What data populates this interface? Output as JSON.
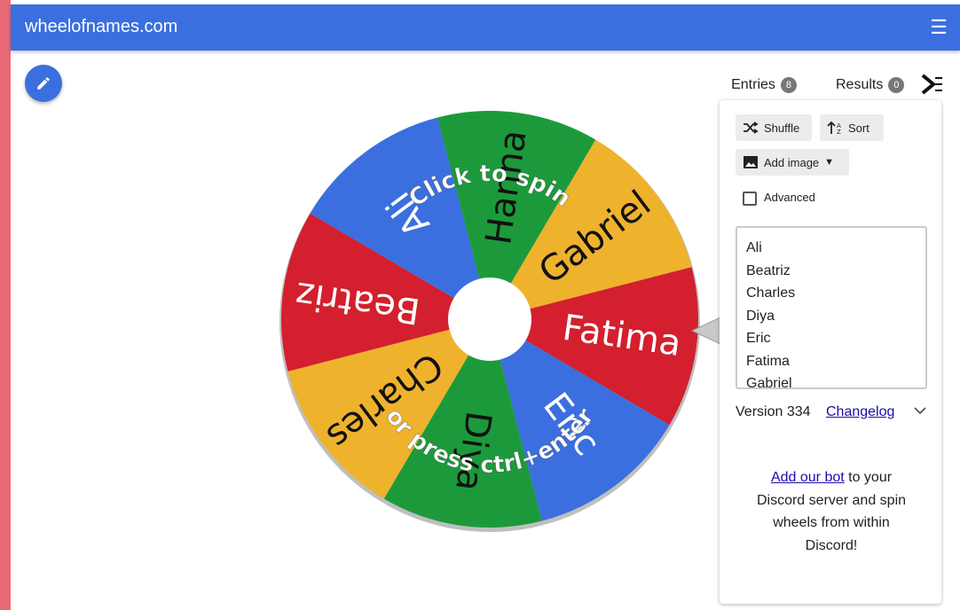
{
  "site": {
    "title": "wheelofnames.com"
  },
  "wheel": {
    "entries": [
      "Ali",
      "Beatriz",
      "Charles",
      "Diya",
      "Eric",
      "Fatima",
      "Gabriel",
      "Hanna"
    ],
    "segments": [
      {
        "label": "Fatima",
        "color": "#d41f2e"
      },
      {
        "label": "Eric",
        "color": "#3b6fe0"
      },
      {
        "label": "Diya",
        "color": "#1c9a3b"
      },
      {
        "label": "Charles",
        "color": "#eeb22d"
      },
      {
        "label": "Beatriz",
        "color": "#d41f2e"
      },
      {
        "label": "Ali",
        "color": "#3b6fe0"
      },
      {
        "label": "Hanna",
        "color": "#1c9a3b"
      },
      {
        "label": "Gabriel",
        "color": "#eeb22d"
      }
    ],
    "overlay_top": "Click to spin",
    "overlay_bottom": "or press ctrl+enter"
  },
  "tabs": [
    {
      "label": "Entries",
      "count": "8"
    },
    {
      "label": "Results",
      "count": "0"
    }
  ],
  "toolbar": {
    "shuffle": "Shuffle",
    "sort": "Sort",
    "add_image": "Add image"
  },
  "advanced_label": "Advanced",
  "entries_list": [
    "Ali",
    "Beatriz",
    "Charles",
    "Diya",
    "Eric",
    "Fatima",
    "Gabriel"
  ],
  "version": {
    "text": "Version 334",
    "changelog": "Changelog"
  },
  "discord": {
    "link": "Add our bot",
    "text": " to your Discord server and spin wheels from within Discord!"
  },
  "colors": {
    "brand": "#3b6fe0",
    "red": "#d41f2e",
    "green": "#1c9a3b",
    "yellow": "#eeb22d"
  }
}
